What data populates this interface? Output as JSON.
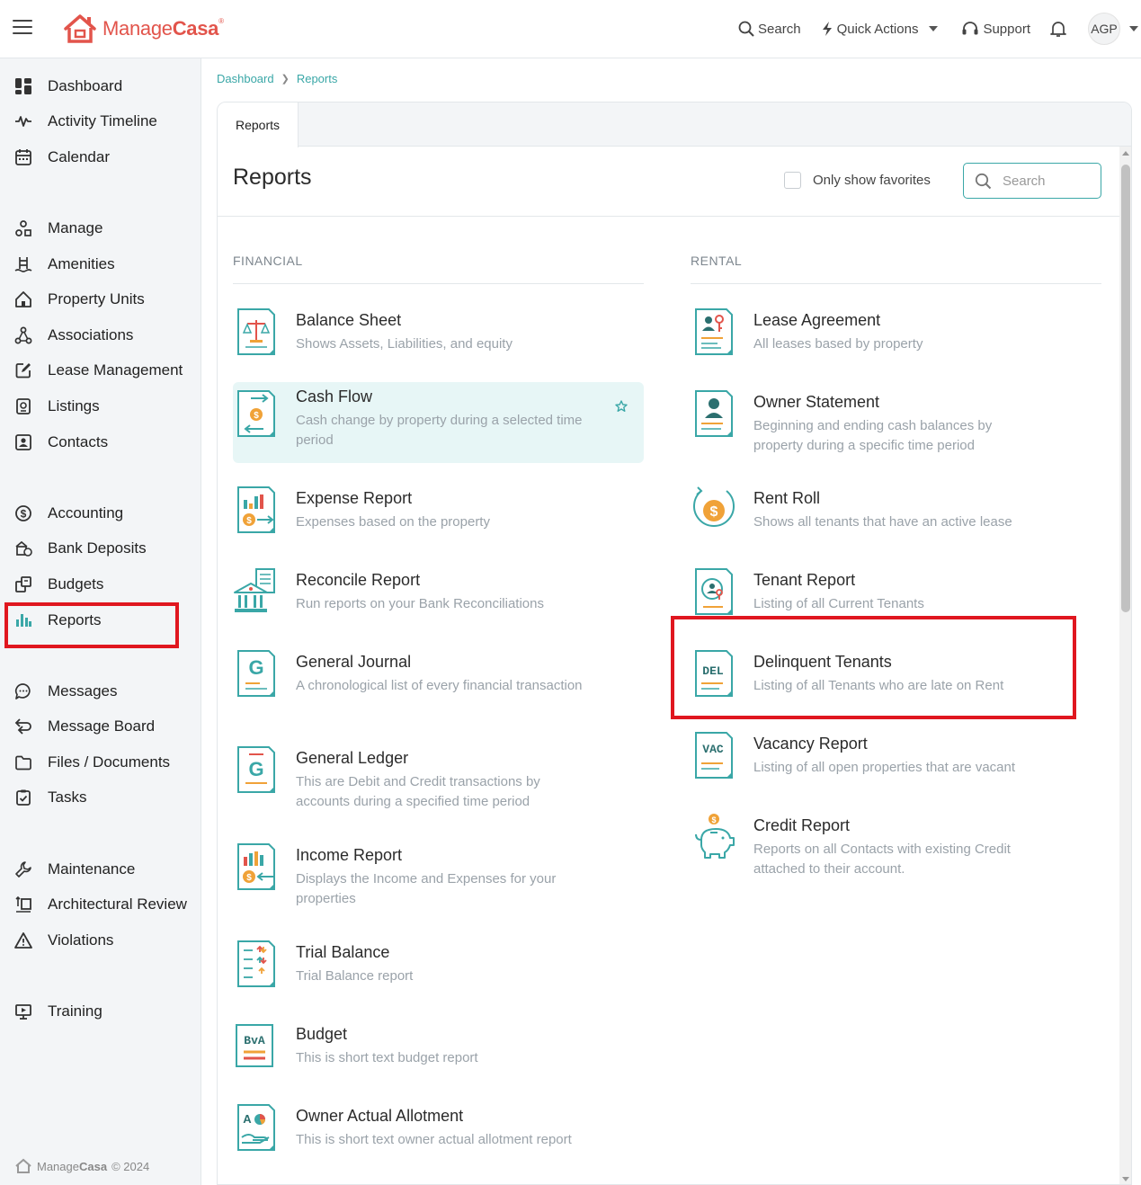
{
  "brand": {
    "part1": "Manage",
    "part2": "Casa",
    "reg": "®",
    "color": "#e2544b"
  },
  "topbar": {
    "search_label": "Search",
    "quick_actions_label": "Quick Actions",
    "support_label": "Support",
    "avatar_initials": "AGP"
  },
  "sidebar": {
    "items": [
      {
        "label": "Dashboard",
        "icon": "dashboard-icon"
      },
      {
        "label": "Activity Timeline",
        "icon": "activity-icon"
      },
      {
        "label": "Calendar",
        "icon": "calendar-icon"
      },
      {
        "label": "Manage",
        "icon": "manage-icon"
      },
      {
        "label": "Amenities",
        "icon": "amenities-icon"
      },
      {
        "label": "Property Units",
        "icon": "home-icon"
      },
      {
        "label": "Associations",
        "icon": "associations-icon"
      },
      {
        "label": "Lease Management",
        "icon": "lease-edit-icon"
      },
      {
        "label": "Listings",
        "icon": "listings-icon"
      },
      {
        "label": "Contacts",
        "icon": "contacts-icon"
      },
      {
        "label": "Accounting",
        "icon": "dollar-icon"
      },
      {
        "label": "Bank Deposits",
        "icon": "bank-deposits-icon"
      },
      {
        "label": "Budgets",
        "icon": "budgets-icon"
      },
      {
        "label": "Reports",
        "icon": "bar-chart-icon"
      },
      {
        "label": "Messages",
        "icon": "chat-icon"
      },
      {
        "label": "Message Board",
        "icon": "message-board-icon"
      },
      {
        "label": "Files / Documents",
        "icon": "folder-icon"
      },
      {
        "label": "Tasks",
        "icon": "tasks-icon"
      },
      {
        "label": "Maintenance",
        "icon": "wrench-icon"
      },
      {
        "label": "Architectural Review",
        "icon": "architectural-icon"
      },
      {
        "label": "Violations",
        "icon": "warning-icon"
      },
      {
        "label": "Training",
        "icon": "training-icon"
      }
    ],
    "active": "Reports",
    "footer": {
      "name1": "Manage",
      "name2": "Casa",
      "copyright": "© 2024"
    }
  },
  "breadcrumb": [
    "Dashboard",
    "Reports"
  ],
  "tab_label": "Reports",
  "page_title": "Reports",
  "favorites_label": "Only show favorites",
  "search_placeholder": "Search",
  "accent_color": "#3aa7a7",
  "highlight_color": "#e0171f",
  "financial": {
    "heading": "FINANCIAL",
    "reports": [
      {
        "title": "Balance Sheet",
        "desc": "Shows Assets, Liabilities, and equity",
        "icon": "balance-scale-icon"
      },
      {
        "title": "Cash Flow",
        "desc": "Cash change by property during a selected time period",
        "icon": "cash-flow-icon"
      },
      {
        "title": "Expense Report",
        "desc": "Expenses based on the property",
        "icon": "expense-icon"
      },
      {
        "title": "Reconcile Report",
        "desc": "Run reports on your Bank Reconciliations",
        "icon": "bank-icon"
      },
      {
        "title": "General Journal",
        "desc": "A chronological list of every financial transaction",
        "icon": "journal-icon",
        "glyph": "G"
      },
      {
        "title": "General Ledger",
        "desc": "This are Debit and Credit transactions by accounts during a specified time period",
        "icon": "ledger-icon",
        "glyph": "G"
      },
      {
        "title": "Income Report",
        "desc": "Displays the Income and Expenses for your properties",
        "icon": "income-icon"
      },
      {
        "title": "Trial Balance",
        "desc": "Trial Balance report",
        "icon": "trial-balance-icon"
      },
      {
        "title": "Budget",
        "desc": "This is short text budget report",
        "icon": "budget-icon",
        "glyph": "BvA"
      },
      {
        "title": "Owner Actual Allotment",
        "desc": "This is short text owner actual allotment report",
        "icon": "allotment-icon",
        "glyph": "A"
      }
    ]
  },
  "rental": {
    "heading": "RENTAL",
    "reports": [
      {
        "title": "Lease Agreement",
        "desc": "All leases based by property",
        "icon": "lease-agreement-icon"
      },
      {
        "title": "Owner Statement",
        "desc": "Beginning and ending cash balances by property during a specific time period",
        "icon": "owner-statement-icon"
      },
      {
        "title": "Rent Roll",
        "desc": "Shows all tenants that have an active lease",
        "icon": "rent-roll-icon"
      },
      {
        "title": "Tenant Report",
        "desc": "Listing of all Current Tenants",
        "icon": "tenant-report-icon"
      },
      {
        "title": "Delinquent Tenants",
        "desc": "Listing of all Tenants who are late on Rent",
        "icon": "delinquent-icon",
        "glyph": "DEL"
      },
      {
        "title": "Vacancy Report",
        "desc": "Listing of all open properties that are vacant",
        "icon": "vacancy-icon",
        "glyph": "VAC"
      },
      {
        "title": "Credit Report",
        "desc": "Reports on all Contacts with existing Credit attached to their account.",
        "icon": "piggy-bank-icon"
      }
    ]
  }
}
